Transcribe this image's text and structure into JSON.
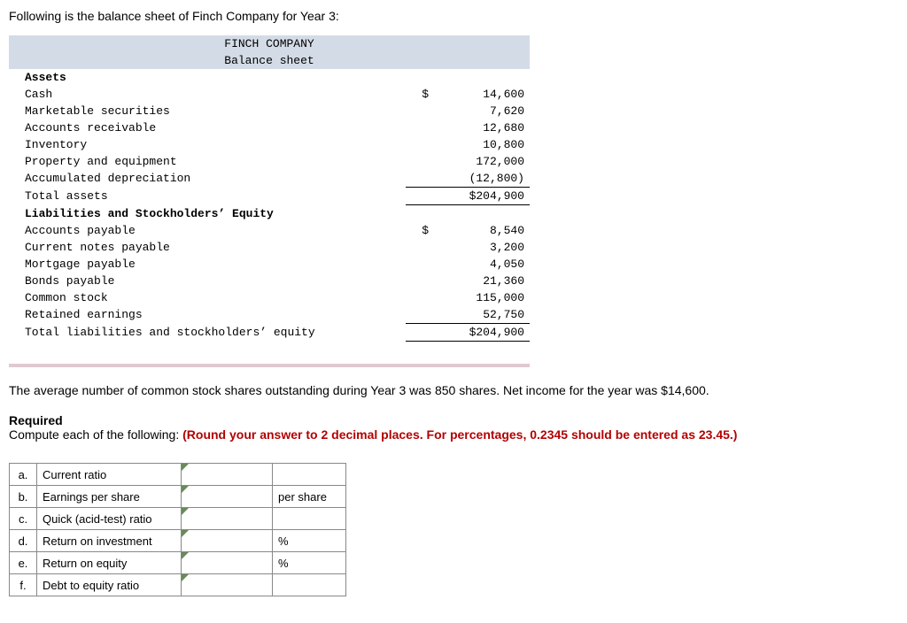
{
  "intro": "Following is the balance sheet of Finch Company for Year 3:",
  "bs": {
    "company": "FINCH COMPANY",
    "title": "Balance sheet",
    "assets_header": "Assets",
    "rows_assets": [
      {
        "label": "Cash",
        "dollar": "$",
        "value": "14,600"
      },
      {
        "label": "Marketable securities",
        "dollar": "",
        "value": "7,620"
      },
      {
        "label": "Accounts receivable",
        "dollar": "",
        "value": "12,680"
      },
      {
        "label": "Inventory",
        "dollar": "",
        "value": "10,800"
      },
      {
        "label": "Property and equipment",
        "dollar": "",
        "value": "172,000"
      },
      {
        "label": "Accumulated depreciation",
        "dollar": "",
        "value": "(12,800)"
      }
    ],
    "total_assets_label": "Total assets",
    "total_assets_value": "$204,900",
    "liab_header": "Liabilities and Stockholders’ Equity",
    "rows_liab": [
      {
        "label": "Accounts payable",
        "dollar": "$",
        "value": "8,540"
      },
      {
        "label": "Current notes payable",
        "dollar": "",
        "value": "3,200"
      },
      {
        "label": "Mortgage payable",
        "dollar": "",
        "value": "4,050"
      },
      {
        "label": "Bonds payable",
        "dollar": "",
        "value": "21,360"
      },
      {
        "label": "Common stock",
        "dollar": "",
        "value": "115,000"
      },
      {
        "label": "Retained earnings",
        "dollar": "",
        "value": "52,750"
      }
    ],
    "total_liab_label": "Total liabilities and stockholders’ equity",
    "total_liab_value": "$204,900"
  },
  "notes": "The average number of common stock shares outstanding during Year 3 was 850 shares. Net income for the year was $14,600.",
  "required_head": "Required",
  "required_text_pre": "Compute each of the following: ",
  "required_text_red": "(Round your answer to 2 decimal places. For percentages, 0.2345 should be entered as 23.45.)",
  "answers": [
    {
      "letter": "a.",
      "name": "Current ratio",
      "unit": ""
    },
    {
      "letter": "b.",
      "name": "Earnings per share",
      "unit": "per share"
    },
    {
      "letter": "c.",
      "name": "Quick (acid-test) ratio",
      "unit": ""
    },
    {
      "letter": "d.",
      "name": "Return on investment",
      "unit": "%"
    },
    {
      "letter": "e.",
      "name": "Return on equity",
      "unit": "%"
    },
    {
      "letter": "f.",
      "name": "Debt to equity ratio",
      "unit": ""
    }
  ]
}
